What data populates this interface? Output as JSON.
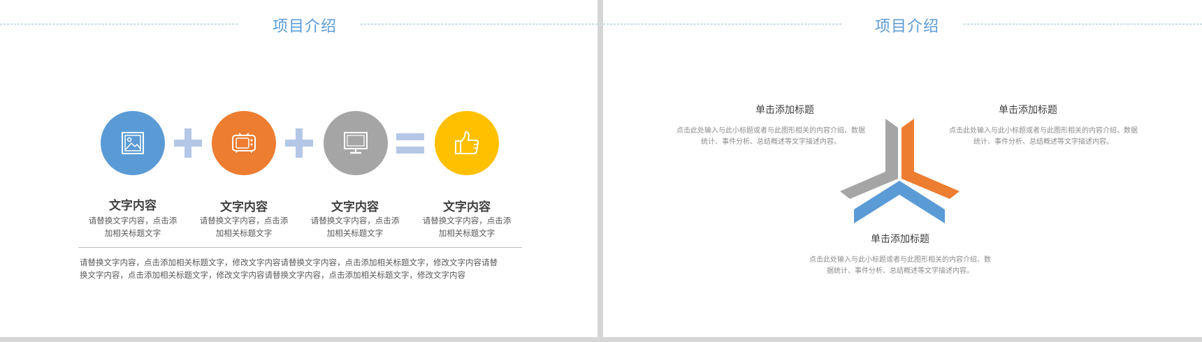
{
  "left_slide": {
    "title": "项目介绍",
    "items": [
      {
        "title": "文字内容",
        "desc_line1": "请替换文字内容，点击添",
        "desc_line2": "加相关标题文字",
        "color": "#5b9bd5",
        "icon": "image-icon"
      },
      {
        "title": "文字内容",
        "desc_line1": "请替换文字内容，点击添",
        "desc_line2": "加相关标题文字",
        "color": "#ed7d31",
        "icon": "tv-icon"
      },
      {
        "title": "文字内容",
        "desc_line1": "请替换文字内容，点击添",
        "desc_line2": "加相关标题文字",
        "color": "#a5a5a5",
        "icon": "monitor-icon"
      },
      {
        "title": "文字内容",
        "desc_line1": "请替换文字内容，点击添",
        "desc_line2": "加相关标题文字",
        "color": "#ffc000",
        "icon": "thumbs-up-icon"
      }
    ],
    "operator_color": "#b4c7e7",
    "paragraph_line1": "请替换文字内容，点击添加相关标题文字，修改文字内容请替换文字内容，点击添加相关标题文字，修改文字内容请替",
    "paragraph_line2": "换文字内容，点击添加相关标题文字，修改文字内容请替换文字内容，点击添加相关标题文字，修改文字内容"
  },
  "right_slide": {
    "title": "项目介绍",
    "blocks": [
      {
        "title": "单击添加标题",
        "desc_line1": "点击此处输入与此小标题或者与此图形相关的内容介绍、数据",
        "desc_line2": "统计、事件分析、总结概述等文字描述内容。"
      },
      {
        "title": "单击添加标题",
        "desc_line1": "点击此处输入与此小标题或者与此图形相关的内容介绍、数据",
        "desc_line2": "统计、事件分析、总结概述等文字描述内容。"
      },
      {
        "title": "单击添加标题",
        "desc_line1": "点击此处输入与此小标题或者与此图形相关的内容介绍、数",
        "desc_line2": "据统计、事件分析、总结概述等文字描述内容。"
      }
    ],
    "chevron_colors": {
      "gray": "#a5a5a5",
      "orange": "#ed7d31",
      "blue": "#5b9bd5"
    }
  },
  "title_color": "#5b9bd5",
  "rule_color": "#8fc2cf"
}
